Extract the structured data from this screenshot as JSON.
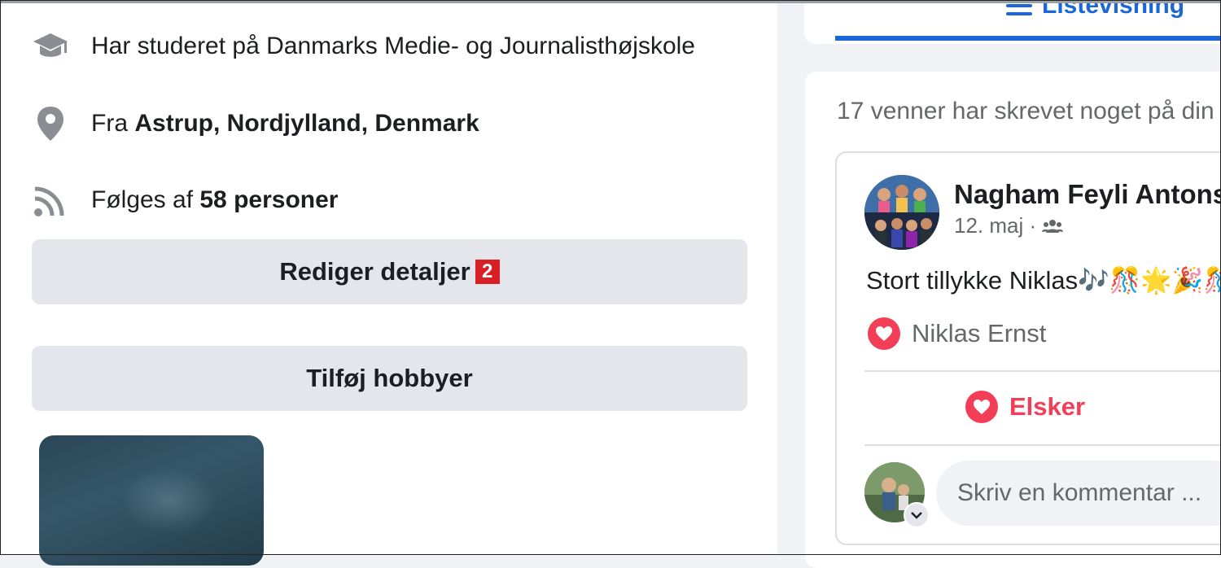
{
  "about": {
    "education_text": "Har studeret på Danmarks Medie- og Journalisthøjskole",
    "from_prefix": "Fra ",
    "from_place": "Astrup, Nordjylland, Denmark",
    "followers_prefix": "Følges af ",
    "followers_count": "58 personer",
    "edit_details_label": "Rediger detaljer",
    "edit_details_badge": "2",
    "add_hobbies_label": "Tilføj hobbyer"
  },
  "view_tabs": {
    "list_view_label": "Listevisning"
  },
  "wall": {
    "summary": "17 venner har skrevet noget på din",
    "post": {
      "author": "Nagham Feyli Antonse",
      "date": "12. maj",
      "separator": " · ",
      "audience_icon": "friends-icon",
      "message": "Stort tillykke Niklas🎶🎊🌟🎉🎊",
      "reactor": "Niklas Ernst",
      "love_label": "Elsker",
      "comment_placeholder": "Skriv en kommentar ..."
    }
  },
  "colors": {
    "accent": "#1b66d8",
    "love": "#f33e58",
    "button_bg": "#e4e6eb",
    "badge": "#d81f26"
  }
}
